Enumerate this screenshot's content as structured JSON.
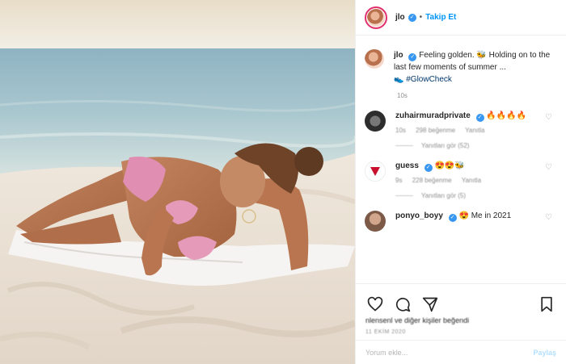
{
  "header": {
    "username": "jlo",
    "separator": "•",
    "follow_label": "Takip Et"
  },
  "caption": {
    "username": "jlo",
    "text": "Feeling golden. 🐝 Holding on to the last few moments of summer ...",
    "emoji_prefix": "👟",
    "hashtag": "#GlowCheck",
    "time": "10s"
  },
  "comments": [
    {
      "username": "zuhairmuradprivate",
      "text": "🔥🔥🔥🔥",
      "time": "10s",
      "likes": "298 beğenme",
      "reply": "Yanıtla",
      "view_replies": "Yanıtları gör (52)",
      "avatar_color": "#3a3a3a"
    },
    {
      "username": "guess",
      "text": "😍😍🐝",
      "time": "9s",
      "likes": "228 beğenme",
      "reply": "Yanıtla",
      "view_replies": "Yanıtları gör (5)",
      "avatar_color": "#ffffff"
    },
    {
      "username": "ponyo_boyy",
      "text": "😍 Me in 2021",
      "time": "",
      "likes": "",
      "reply": "",
      "view_replies": "",
      "avatar_color": "#a47864"
    }
  ],
  "actions": {
    "like_icon": "heart-icon",
    "comment_icon": "comment-icon",
    "share_icon": "paper-plane-icon",
    "save_icon": "bookmark-icon"
  },
  "likes_text": "nlensenl ve diğer kişiler beğendi",
  "date_text": "11 EKİM 2020",
  "add_comment": {
    "placeholder": "Yorum ekle...",
    "send_label": "Paylaş"
  },
  "colors": {
    "accent": "#0095f6",
    "verified": "#3897f0"
  }
}
